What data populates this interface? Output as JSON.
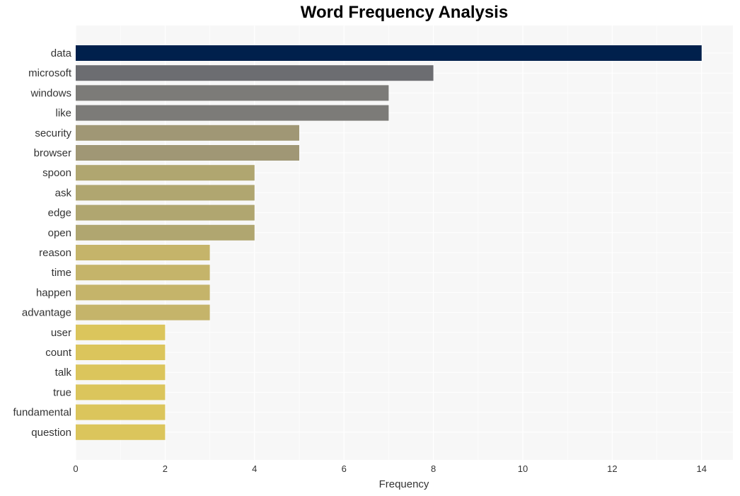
{
  "chart_data": {
    "type": "bar",
    "orientation": "horizontal",
    "title": "Word Frequency Analysis",
    "xlabel": "Frequency",
    "ylabel": "",
    "xlim": [
      0,
      14.7
    ],
    "xticks": [
      0,
      2,
      4,
      6,
      8,
      10,
      12,
      14
    ],
    "grid": true,
    "categories": [
      "data",
      "microsoft",
      "windows",
      "like",
      "security",
      "browser",
      "spoon",
      "ask",
      "edge",
      "open",
      "reason",
      "time",
      "happen",
      "advantage",
      "user",
      "count",
      "talk",
      "true",
      "fundamental",
      "question"
    ],
    "values": [
      14,
      8,
      7,
      7,
      5,
      5,
      4,
      4,
      4,
      4,
      3,
      3,
      3,
      3,
      2,
      2,
      2,
      2,
      2,
      2
    ],
    "colors": [
      "#00204c",
      "#6c6d71",
      "#7c7b78",
      "#7c7b78",
      "#a09775",
      "#a09775",
      "#b0a670",
      "#b0a670",
      "#b0a670",
      "#b0a670",
      "#c5b46a",
      "#c5b46a",
      "#c5b46a",
      "#c5b46a",
      "#dbc55c",
      "#dbc55c",
      "#dbc55c",
      "#dbc55c",
      "#dbc55c",
      "#dbc55c"
    ]
  }
}
